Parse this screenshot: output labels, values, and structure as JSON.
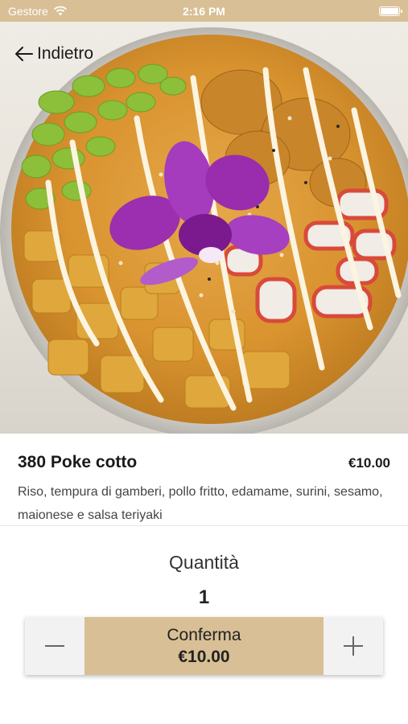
{
  "status_bar": {
    "carrier": "Gestore",
    "time": "2:16 PM"
  },
  "nav": {
    "back_label": "Indietro"
  },
  "product": {
    "title": "380 Poke cotto",
    "price": "€10.00",
    "description": "Riso, tempura di gamberi, pollo fritto, edamame, surini, sesamo, maionese e salsa teriyaki"
  },
  "quantity": {
    "label": "Quantità",
    "value": "1"
  },
  "actions": {
    "confirm_label": "Conferma",
    "confirm_price": "€10.00",
    "decrement_icon": "minus-icon",
    "increment_icon": "plus-icon"
  },
  "colors": {
    "accent": "#d8bf95",
    "stepper_bg": "#f2f2f2"
  }
}
